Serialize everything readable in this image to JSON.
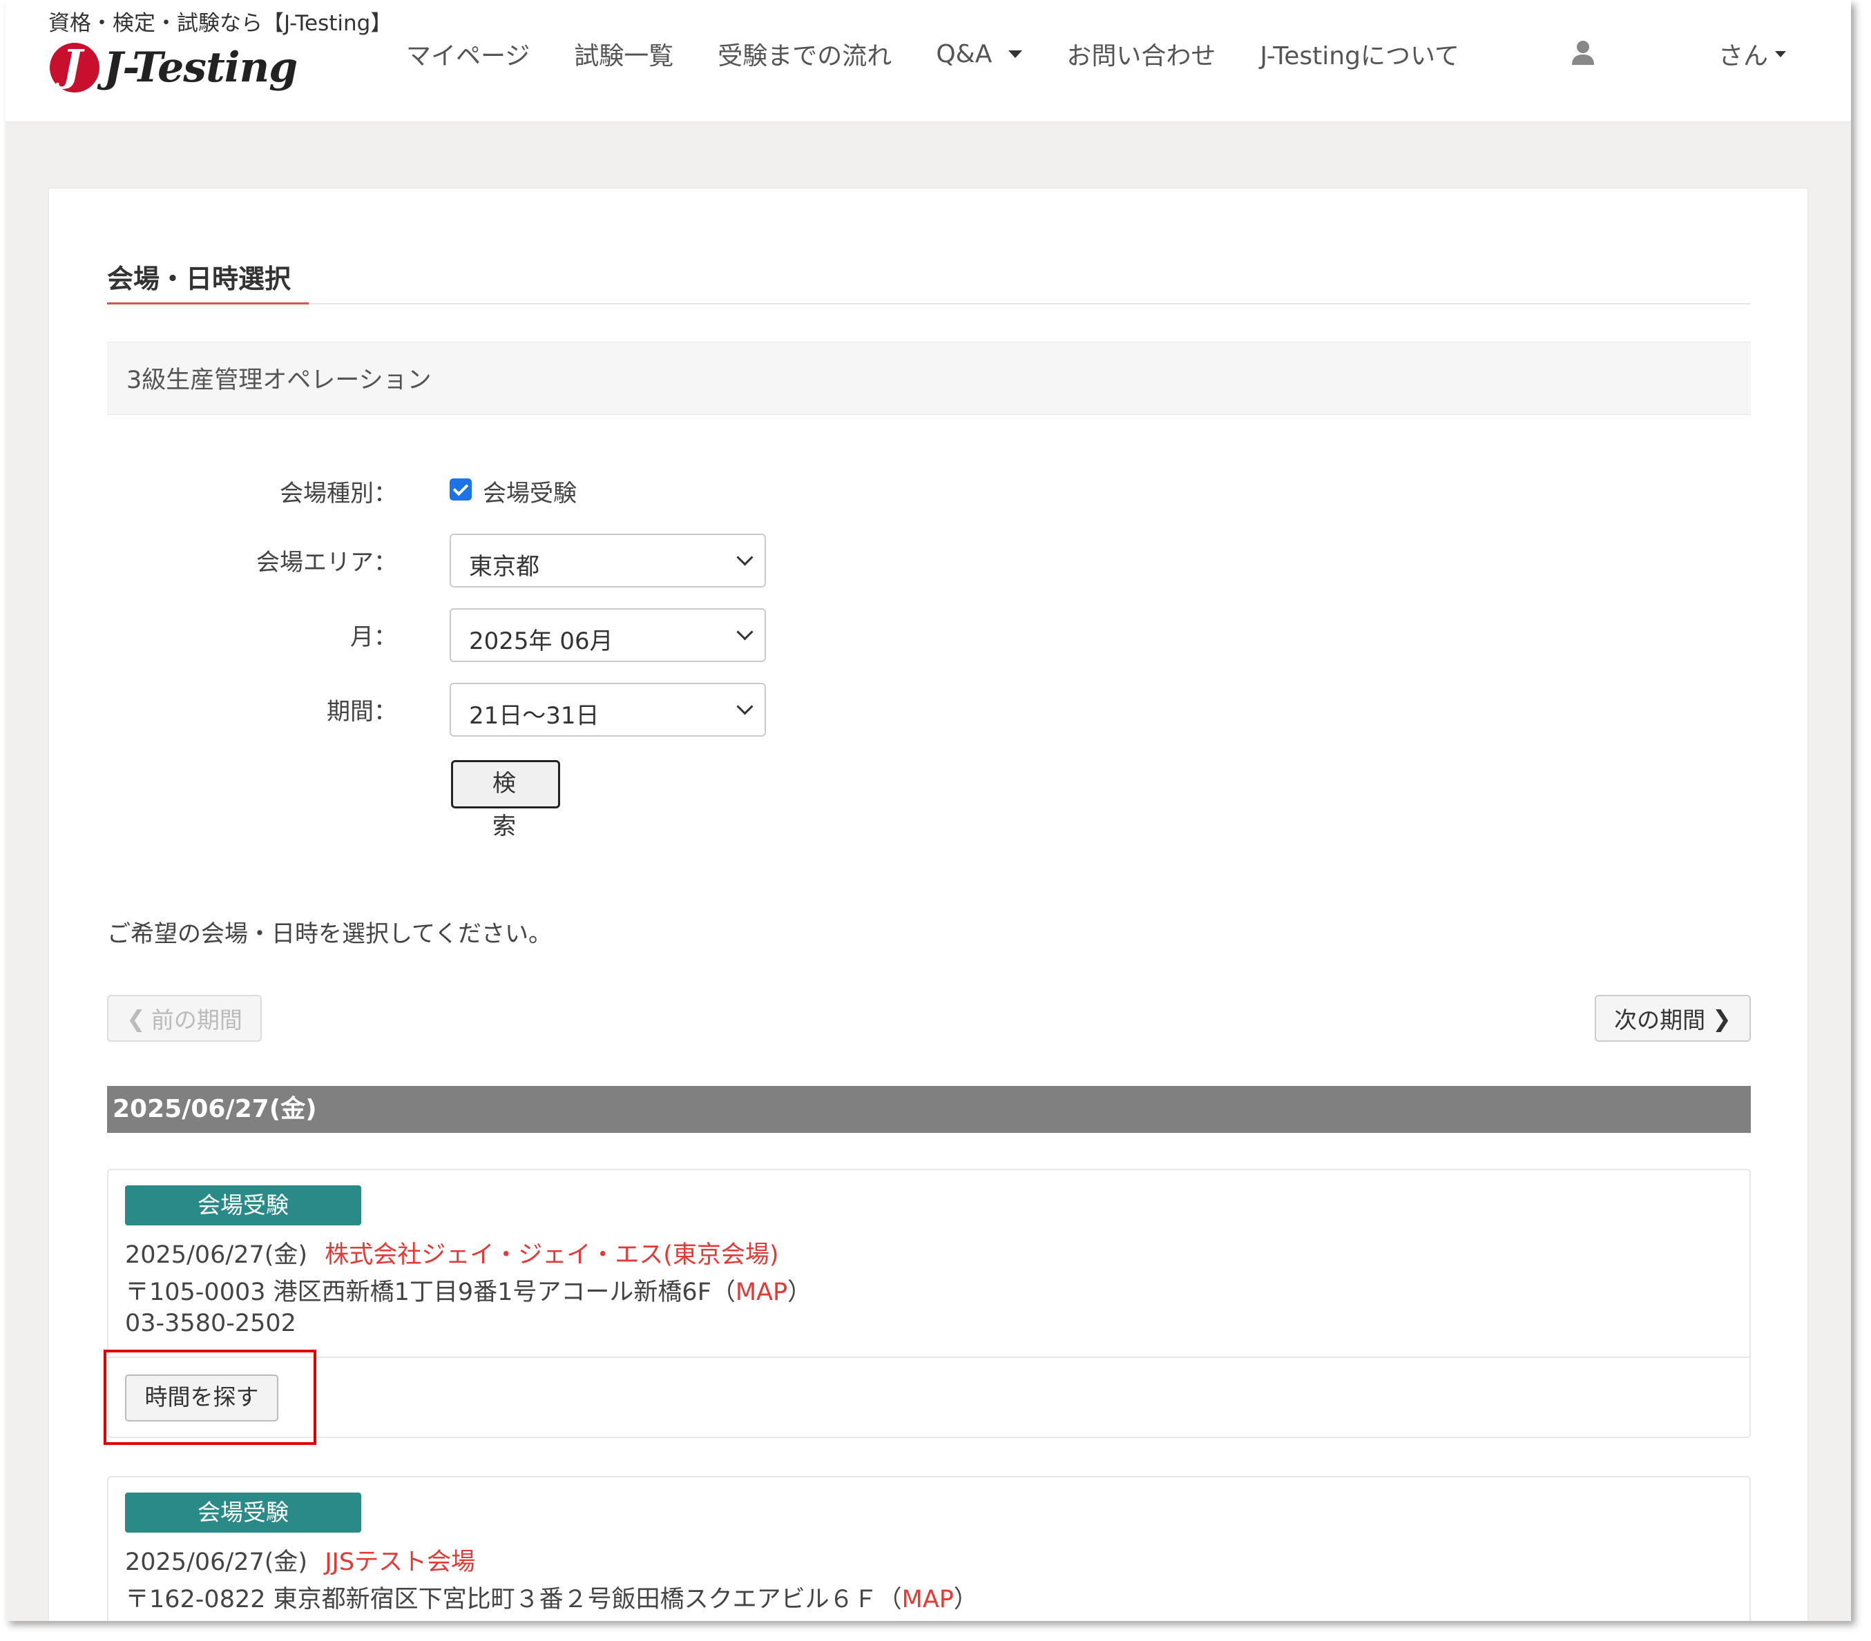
{
  "header": {
    "tagline": "資格・検定・試験なら【J-Testing】",
    "logo_text": "J-Testing",
    "nav": [
      {
        "label": "マイページ"
      },
      {
        "label": "試験一覧"
      },
      {
        "label": "受験までの流れ"
      },
      {
        "label": "Q&A"
      },
      {
        "label": "お問い合わせ"
      },
      {
        "label": "J-Testingについて"
      }
    ],
    "user_menu": "さん"
  },
  "page": {
    "title": "会場・日時選択",
    "exam_name": "3級生産管理オペレーション"
  },
  "form": {
    "venue_type_label": "会場種別：",
    "venue_type_option": "会場受験",
    "venue_type_checked": true,
    "area_label": "会場エリア：",
    "area_value": "東京都",
    "month_label": "月：",
    "month_value": "2025年 06月",
    "period_label": "期間：",
    "period_value": "21日～31日",
    "search_button": "検 索"
  },
  "results": {
    "instruction": "ご希望の会場・日時を選択してください。",
    "prev_label": "前の期間",
    "next_label": "次の期間",
    "date_header": "2025/06/27(金)",
    "venues": [
      {
        "badge": "会場受験",
        "date": "2025/06/27(金)",
        "name": "株式会社ジェイ・ジェイ・エス(東京会場)",
        "address": "〒105-0003 港区西新橋1丁目9番1号アコール新橋6F",
        "map_open": "（",
        "map_label": "MAP",
        "map_close": "）",
        "phone": "03-3580-2502",
        "find_button": "時間を探す"
      },
      {
        "badge": "会場受験",
        "date": "2025/06/27(金)",
        "name": "JJSテスト会場",
        "address": "〒162-0822 東京都新宿区下宮比町３番２号飯田橋スクエアビル６Ｆ",
        "map_open": "（",
        "map_label": "MAP",
        "map_close": "）"
      }
    ]
  },
  "colors": {
    "accent_red": "#e53935",
    "badge_teal": "#2a8a87",
    "date_bar_gray": "#808080",
    "highlight_red": "#e00000"
  }
}
